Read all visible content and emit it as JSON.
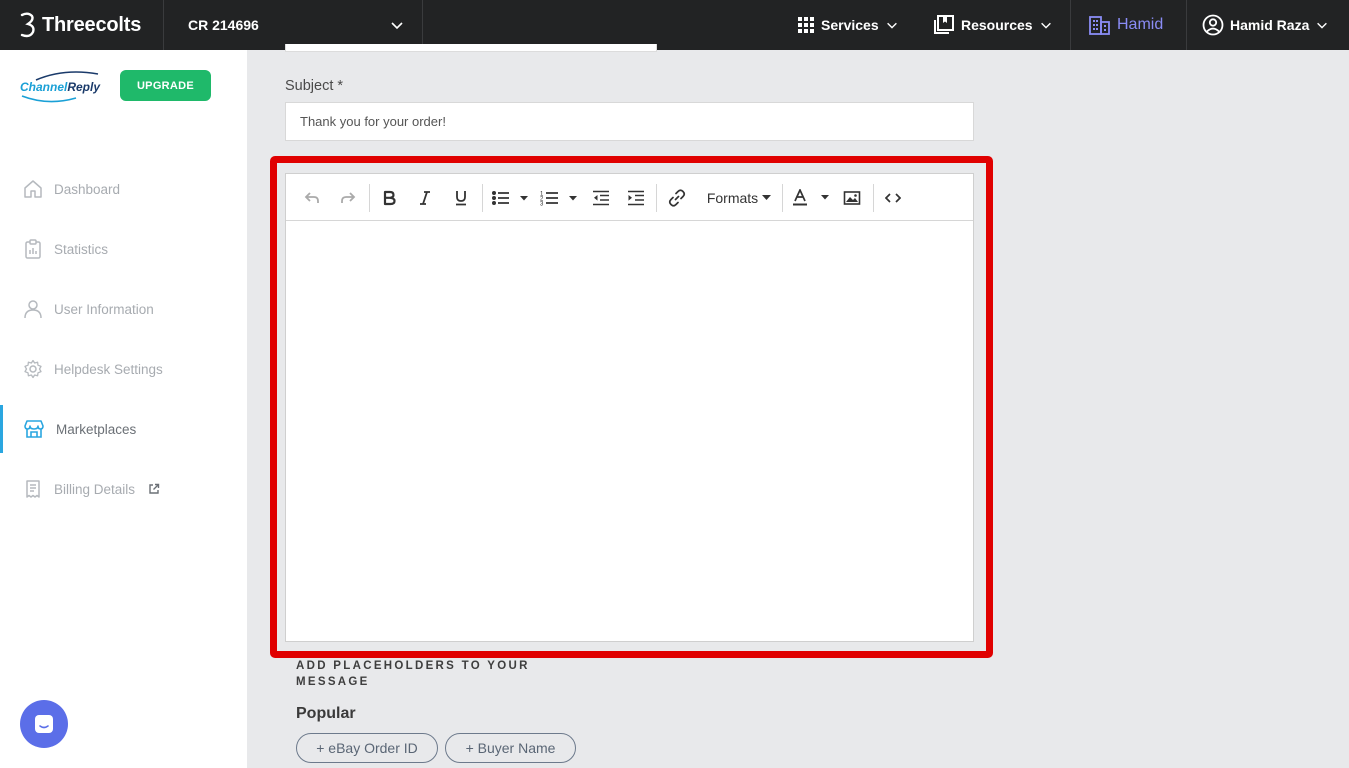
{
  "topbar": {
    "brand": "Threecolts",
    "account": "CR 214696",
    "services": "Services",
    "resources": "Resources",
    "workspace": "Hamid",
    "user": "Hamid Raza"
  },
  "sidebar": {
    "logo_part1": "Channel",
    "logo_part2": "Reply",
    "upgrade": "UPGRADE",
    "items": [
      {
        "label": "Dashboard",
        "icon": "home-icon"
      },
      {
        "label": "Statistics",
        "icon": "clipboard-chart-icon"
      },
      {
        "label": "User Information",
        "icon": "user-icon"
      },
      {
        "label": "Helpdesk Settings",
        "icon": "gear-icon"
      },
      {
        "label": "Marketplaces",
        "icon": "store-icon",
        "active": true
      },
      {
        "label": "Billing Details",
        "icon": "receipt-icon",
        "external": true
      }
    ]
  },
  "form": {
    "subject_label": "Subject *",
    "subject_value": "Thank you for your order!",
    "editor_content": ""
  },
  "toolbar": {
    "formats": "Formats"
  },
  "placeholders": {
    "title": "ADD PLACEHOLDERS TO YOUR MESSAGE",
    "popular": "Popular",
    "chips": [
      "+ eBay Order ID",
      "+ Buyer Name"
    ]
  },
  "colors": {
    "topbar": "#222324",
    "accent_purple": "#8a8cf5",
    "upgrade_green": "#1fb96a",
    "active_blue": "#2aa6e0",
    "highlight_red": "#e00000",
    "chat_bubble": "#5b6ee8"
  }
}
